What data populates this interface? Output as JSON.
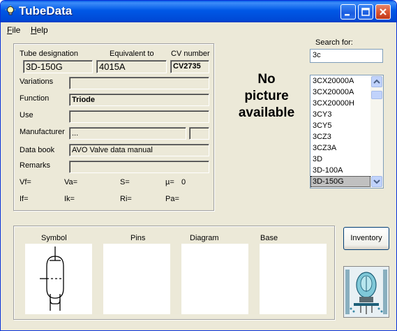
{
  "window": {
    "title": "TubeData",
    "icon": "lightbulb-icon"
  },
  "menu": {
    "file": "File",
    "file_mnemonic": "F",
    "file_rest": "ile",
    "help": "Help",
    "help_mnemonic": "H",
    "help_rest": "elp"
  },
  "details": {
    "tube_designation_label": "Tube designation",
    "tube_designation": "3D-150G",
    "equivalent_label": "Equivalent to",
    "equivalent": "4015A",
    "cv_label": "CV number",
    "cv": "CV2735",
    "variations_label": "Variations",
    "variations": "",
    "function_label": "Function",
    "function": "Triode",
    "use_label": "Use",
    "use": "",
    "manufacturer_label": "Manufacturer",
    "manufacturer": "...",
    "manufacturer_code": "",
    "databook_label": "Data book",
    "databook": "AVO Valve data manual",
    "remarks_label": "Remarks",
    "remarks": "",
    "vf_label": "Vf=",
    "va_label": "Va=",
    "s_label": "S=",
    "mu_label": "µ=",
    "mu_value": "0",
    "if_label": "If=",
    "ik_label": "Ik=",
    "ri_label": "Ri=",
    "pa_label": "Pa="
  },
  "picture": {
    "no_picture_line1": "No",
    "no_picture_line2": "picture",
    "no_picture_line3": "available"
  },
  "search": {
    "label": "Search for:",
    "value": "3c",
    "results": [
      "3CX20000A",
      "3CX20000A",
      "3CX20000H",
      "3CY3",
      "3CY5",
      "3CZ3",
      "3CZ3A",
      "3D",
      "3D-100A",
      "3D-150G"
    ],
    "selected_index": 9
  },
  "panels": {
    "symbol": "Symbol",
    "pins": "Pins",
    "diagram": "Diagram",
    "base": "Base"
  },
  "inventory_button": "Inventory",
  "colors": {
    "titlebar": "#0058E6",
    "window_bg": "#ECE9D8",
    "close_button": "#D8532F",
    "selection": "#C0C0C0"
  }
}
